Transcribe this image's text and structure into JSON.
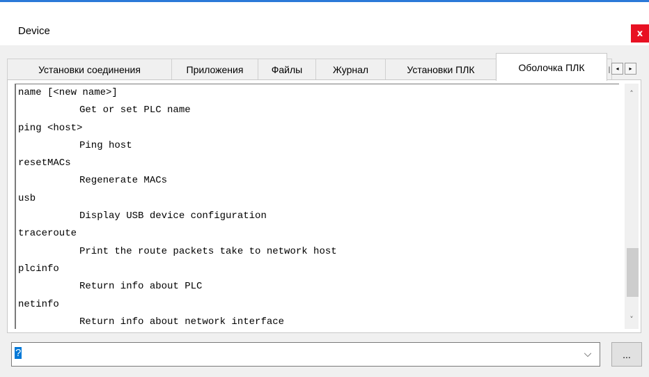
{
  "window": {
    "title": "Device",
    "close_icon": "close-icon",
    "close_label": "x"
  },
  "tabs": [
    {
      "label": "Установки соединения",
      "active": false
    },
    {
      "label": "Приложения",
      "active": false
    },
    {
      "label": "Файлы",
      "active": false
    },
    {
      "label": "Журнал",
      "active": false
    },
    {
      "label": "Установки ПЛК",
      "active": false
    },
    {
      "label": "Оболочка ПЛК",
      "active": true
    },
    {
      "label": "I",
      "active": false
    }
  ],
  "tab_scroll": {
    "left_icon": "◂",
    "right_icon": "▸"
  },
  "console": {
    "lines": [
      {
        "text": "name [<new name>]",
        "indent": false
      },
      {
        "text": "Get or set PLC name",
        "indent": true
      },
      {
        "text": "ping <host>",
        "indent": false
      },
      {
        "text": "Ping host",
        "indent": true
      },
      {
        "text": "resetMACs",
        "indent": false
      },
      {
        "text": "Regenerate MACs",
        "indent": true
      },
      {
        "text": "usb",
        "indent": false
      },
      {
        "text": "Display USB device configuration",
        "indent": true
      },
      {
        "text": "traceroute",
        "indent": false
      },
      {
        "text": "Print the route packets take to network host",
        "indent": true
      },
      {
        "text": "plcinfo",
        "indent": false
      },
      {
        "text": "Return info about PLC",
        "indent": true
      },
      {
        "text": "netinfo",
        "indent": false
      },
      {
        "text": "Return info about network interface",
        "indent": true
      }
    ]
  },
  "scrollbar": {
    "up_icon": "˄",
    "down_icon": "˅"
  },
  "command": {
    "value": "?",
    "dropdown_icon": "⌵"
  },
  "more_button": {
    "label": "..."
  },
  "colors": {
    "accent": "#2b79d8",
    "close": "#e81123",
    "selection": "#0078d7"
  }
}
